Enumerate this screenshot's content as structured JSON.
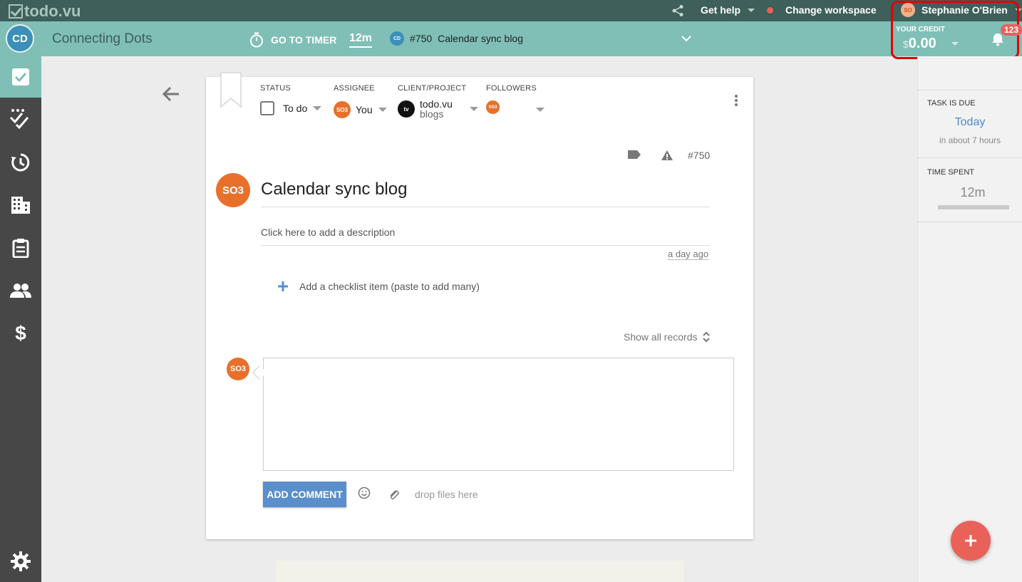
{
  "topbar": {
    "logo_text": "todo.vu",
    "get_help": "Get help",
    "change_workspace": "Change workspace",
    "user_initials": "SO",
    "user_name": "Stephanie O'Brien"
  },
  "subbar": {
    "workspace_initials": "CD",
    "workspace_name": "Connecting Dots",
    "timer_label": "GO TO TIMER",
    "timer_value": "12m",
    "current_task_initials": "CD",
    "current_task_number": "#750",
    "current_task_title": "Calendar sync blog",
    "credit_label": "YOUR CREDIT",
    "credit_currency": "$",
    "credit_value": "0.00",
    "notification_count": "123"
  },
  "sidebar": {
    "items": [
      {
        "icon": "check-square-icon",
        "active": true
      },
      {
        "icon": "checklist-icon",
        "active": false
      },
      {
        "icon": "history-icon",
        "active": false
      },
      {
        "icon": "building-icon",
        "active": false
      },
      {
        "icon": "clipboard-icon",
        "active": false
      },
      {
        "icon": "people-icon",
        "active": false
      },
      {
        "icon": "dollar-icon",
        "active": false
      }
    ],
    "settings_icon": "gear-icon"
  },
  "task": {
    "status_label": "STATUS",
    "status_value": "To do",
    "assignee_label": "ASSIGNEE",
    "assignee_initials": "SO3",
    "assignee_value": "You",
    "project_label": "CLIENT/PROJECT",
    "project_initials": "tv",
    "project_client": "todo.vu",
    "project_name": "blogs",
    "followers_label": "FOLLOWERS",
    "follower_initials": "SO3",
    "number": "#750",
    "owner_initials": "SO3",
    "title": "Calendar sync blog",
    "description_placeholder": "Click here to add a description",
    "time_ago": "a day ago",
    "checklist_placeholder": "Add a checklist item (paste to add many)",
    "show_all_records": "Show all records",
    "commenter_initials": "SO3",
    "add_comment": "ADD COMMENT",
    "drop_files": "drop files here"
  },
  "right_panel": {
    "due_label": "TASK IS DUE",
    "due_value": "Today",
    "due_sub": "in about 7 hours",
    "spent_label": "TIME SPENT",
    "spent_value": "12m"
  },
  "colors": {
    "topbar": "#3e5f5a",
    "subbar": "#7fbfb6",
    "sidebar": "#474747",
    "accent_orange": "#e8702a",
    "accent_blue": "#5a8fcc",
    "fab": "#e8625a"
  }
}
